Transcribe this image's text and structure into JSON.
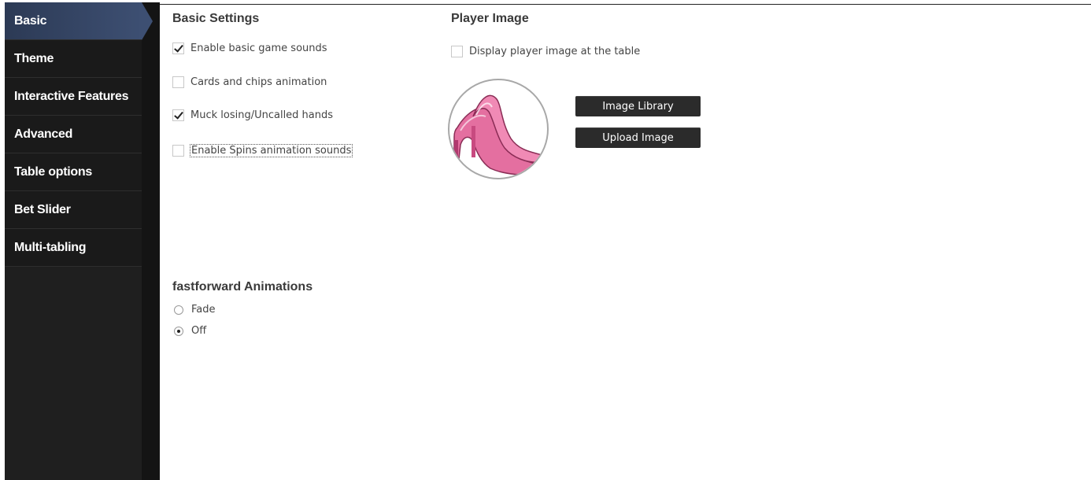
{
  "sidebar": {
    "items": [
      {
        "label": "Basic",
        "active": true
      },
      {
        "label": "Theme"
      },
      {
        "label": "Interactive Features"
      },
      {
        "label": "Advanced"
      },
      {
        "label": "Table options"
      },
      {
        "label": "Bet Slider"
      },
      {
        "label": "Multi-tabling"
      }
    ]
  },
  "basic_settings": {
    "title": "Basic Settings",
    "options": [
      {
        "label": "Enable basic game sounds",
        "checked": true
      },
      {
        "label": "Cards and chips animation",
        "checked": false
      },
      {
        "label": "Muck losing/Uncalled hands",
        "checked": true
      },
      {
        "label": "Enable Spins animation sounds",
        "checked": false
      }
    ]
  },
  "player_image": {
    "title": "Player Image",
    "display_option": {
      "label": "Display player image at the table",
      "checked": false
    },
    "avatar_icon": "pink-high-heel-shoe",
    "image_library_label": "Image Library",
    "upload_image_label": "Upload Image"
  },
  "fastforward": {
    "title": "fastforward Animations",
    "options": [
      {
        "label": "Fade",
        "selected": false
      },
      {
        "label": "Off",
        "selected": true
      }
    ]
  },
  "colors": {
    "sidebar_bg": "#1f1f1f",
    "active_tab": "#3d4f72",
    "button_bg": "#2b2b2b",
    "shoe_pink": "#e46fa0"
  }
}
